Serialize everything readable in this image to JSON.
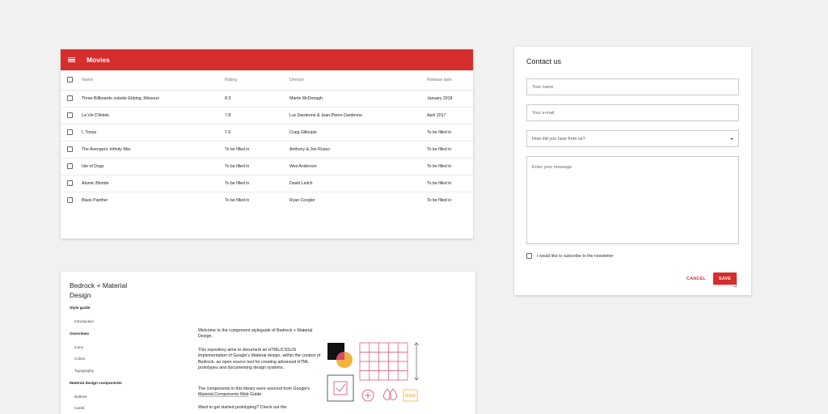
{
  "movies": {
    "title": "Movies",
    "columns": [
      "Name",
      "Rating",
      "Director",
      "Release date"
    ],
    "rows": [
      {
        "name": "Three Billboards outside Ebbing, Missouri",
        "rating": "8.3",
        "director": "Martin McDonagh",
        "release": "January 2018"
      },
      {
        "name": "La Vie D'Adele",
        "rating": "7.8",
        "director": "Luc Dardenne & Jean-Pierre Dardenne",
        "release": "April 2017"
      },
      {
        "name": "I, Tonya",
        "rating": "7.6",
        "director": "Craig Gillespie",
        "release": "To be filled in"
      },
      {
        "name": "The Avengers: Infinity War",
        "rating": "To be filled in",
        "director": "Anthony & Joe Russo",
        "release": "To be filled in"
      },
      {
        "name": "Isle of Dogs",
        "rating": "To be filled in",
        "director": "Wes Anderson",
        "release": "To be filled in"
      },
      {
        "name": "Atomic Blonde",
        "rating": "To be filled in",
        "director": "David Leitch",
        "release": "To be filled in"
      },
      {
        "name": "Black Panther",
        "rating": "To be filled in",
        "director": "Ryan Coogler",
        "release": "To be filled in"
      }
    ]
  },
  "contact": {
    "title": "Contact us",
    "name_placeholder": "Your name",
    "email_placeholder": "Your e-mail",
    "source_placeholder": "How did you hear from us?",
    "message_placeholder": "Enter your message",
    "newsletter_label": "I would like to subscribe to the newsletter",
    "cancel_label": "CANCEL",
    "save_label": "SAVE"
  },
  "guide": {
    "title": "Bedrock + Material Design",
    "nav": {
      "style_guide": "Style guide",
      "introduction": "Introduction",
      "overviews": "Overviews",
      "icons": "Icons",
      "colors": "Colors",
      "typography": "Typography",
      "material_components": "Material design components",
      "buttons": "Buttons",
      "cards": "Cards"
    },
    "p1": "Welcome to the component styleguide of Bedrock + Material Design.",
    "p2": "This repository aims to document an HTML/CSS/JS implementation of Google's Material design, within the context of Bedrock, an open source tool for creating advanced HTML prototypes and documenting design systems.",
    "p3_prefix": "The components in this library were sourced from Google's ",
    "p3_link": "Material Components Web",
    "p3_suffix": " Guide.",
    "p4": "Want to get started prototyping? Check out the"
  },
  "colors": {
    "accent": "#d62d2d",
    "illustration_pink": "#d64a6b",
    "illustration_yellow": "#f2b23b"
  }
}
